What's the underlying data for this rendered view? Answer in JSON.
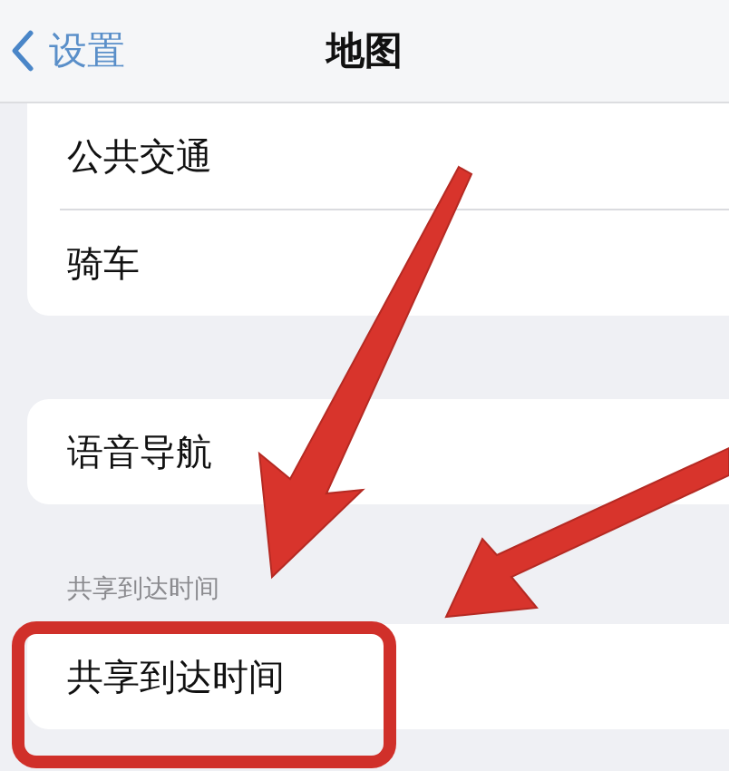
{
  "nav_bar": {
    "back_label": "设置",
    "title": "地图"
  },
  "groups": [
    {
      "rows": [
        {
          "label": "公共交通"
        },
        {
          "label": "骑车"
        }
      ]
    },
    {
      "rows": [
        {
          "label": "语音导航"
        }
      ]
    },
    {
      "header": "共享到达时间",
      "rows": [
        {
          "label": "共享到达时间"
        }
      ]
    }
  ]
}
